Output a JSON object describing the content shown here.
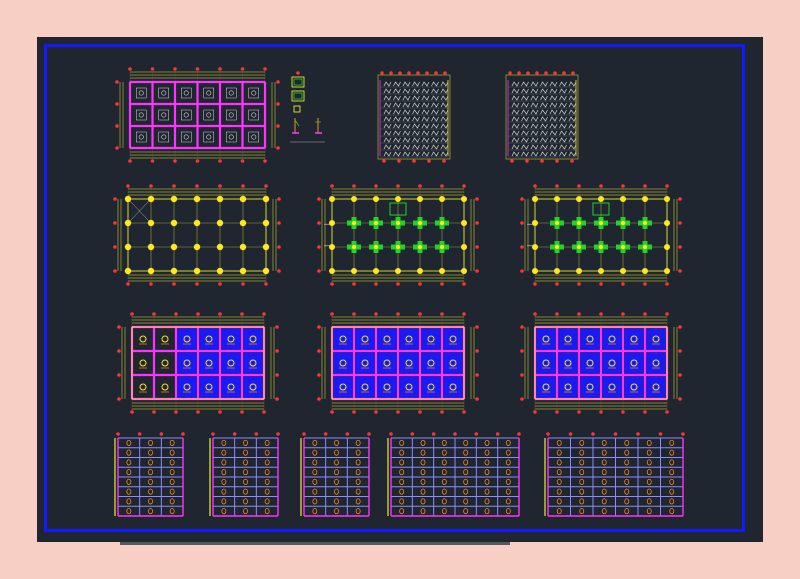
{
  "colors": {
    "background": "#f7cfc4",
    "canvas": "#1f2630",
    "border": "#1219ff",
    "wall": "#ff33ff",
    "outline": "#ffff33",
    "dimension": "#e8e833",
    "grid_bubble": "#ff3333",
    "column": "#ffe81f",
    "footing": "#22d32a",
    "slab_fill": "#1a1af5",
    "rebar": "#ff8c1a",
    "beam": "#8c8cff",
    "detail": "#d8d8d8"
  },
  "drawing": {
    "footing_plan_layout": {
      "cols": 6,
      "rows": 3
    },
    "column_plan_layout": {
      "cols": 6,
      "rows": 3
    },
    "slab_plan_layout": {
      "cols": 6,
      "rows": 3
    },
    "elevation_floors": 8
  }
}
